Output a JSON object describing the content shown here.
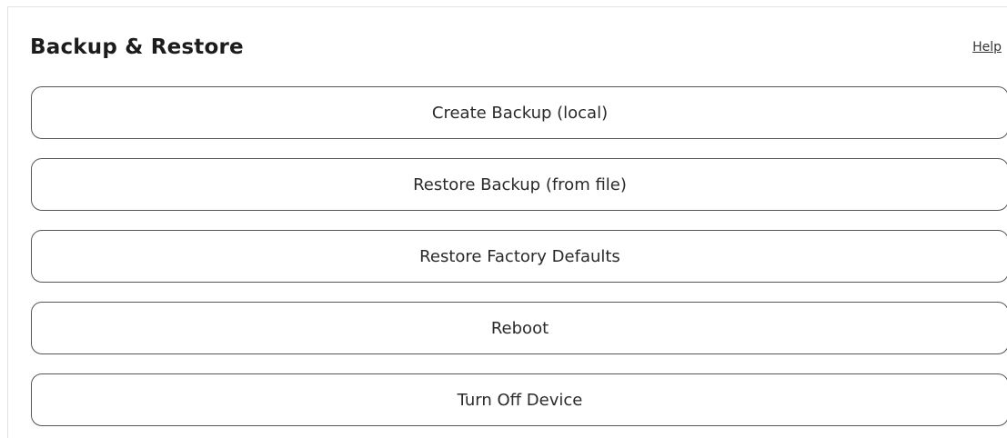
{
  "header": {
    "title": "Backup & Restore",
    "help_label": "Help"
  },
  "actions": [
    {
      "label": "Create Backup (local)"
    },
    {
      "label": "Restore Backup (from file)"
    },
    {
      "label": "Restore Factory Defaults"
    },
    {
      "label": "Reboot"
    },
    {
      "label": "Turn Off Device"
    }
  ]
}
